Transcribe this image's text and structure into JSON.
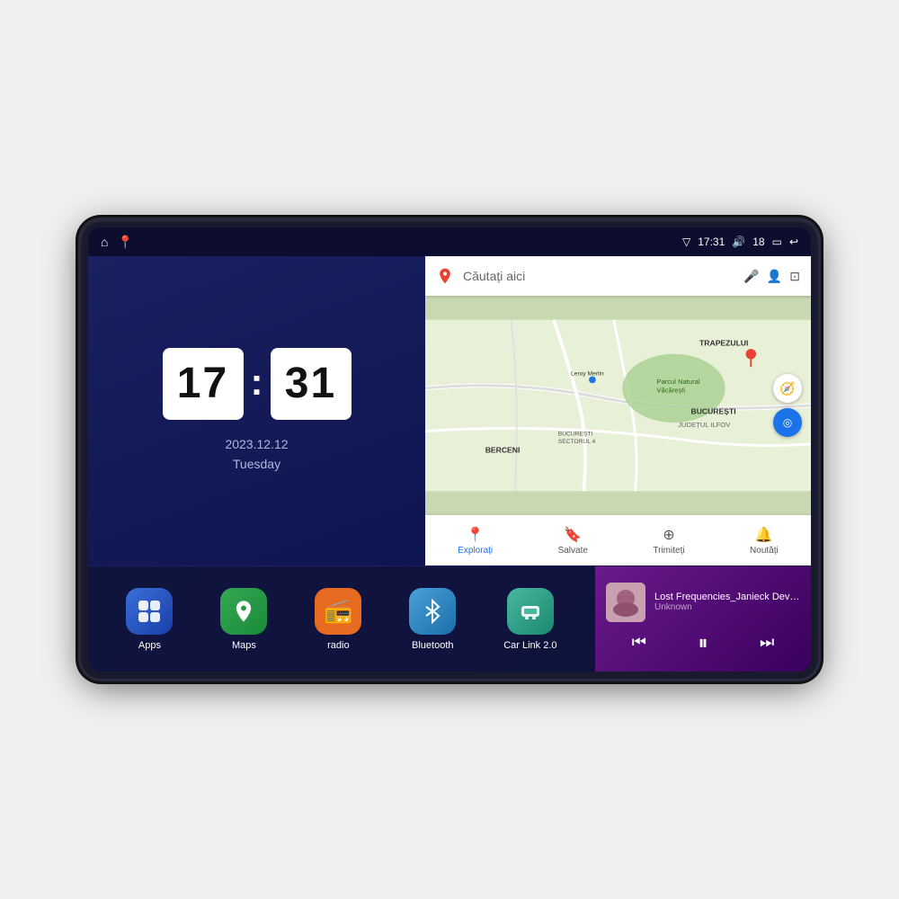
{
  "device": {
    "screen": {
      "status_bar": {
        "left_icons": [
          "home",
          "map-pin"
        ],
        "time": "17:31",
        "signal": "▽",
        "volume": "🔊",
        "battery_level": "18",
        "battery_icon": "🔋",
        "back_icon": "↩"
      },
      "clock": {
        "hours": "17",
        "minutes": "31",
        "date": "2023.12.12",
        "day": "Tuesday"
      },
      "map": {
        "search_placeholder": "Căutați aici",
        "bottom_nav": [
          {
            "label": "Explorați",
            "icon": "📍",
            "active": true
          },
          {
            "label": "Salvate",
            "icon": "🔖",
            "active": false
          },
          {
            "label": "Trimiteți",
            "icon": "⊕",
            "active": false
          },
          {
            "label": "Noutăți",
            "icon": "🔔",
            "active": false
          }
        ],
        "locations": [
          "TRAPEZULUI",
          "BUCUREȘTI",
          "JUDEȚUL ILFOV",
          "BERCENI",
          "Parcul Natural Văcărești",
          "Leroy Merlin",
          "BUCUREȘTI SECTORUL 4"
        ]
      },
      "apps": [
        {
          "id": "apps",
          "label": "Apps",
          "icon": "⊞",
          "bg": "apps-bg"
        },
        {
          "id": "maps",
          "label": "Maps",
          "icon": "📍",
          "bg": "maps-bg"
        },
        {
          "id": "radio",
          "label": "radio",
          "icon": "📻",
          "bg": "radio-bg"
        },
        {
          "id": "bluetooth",
          "label": "Bluetooth",
          "icon": "⚡",
          "bg": "bt-bg"
        },
        {
          "id": "carlink",
          "label": "Car Link 2.0",
          "icon": "🔗",
          "bg": "carlink-bg"
        }
      ],
      "music": {
        "title": "Lost Frequencies_Janieck Devy-...",
        "artist": "Unknown",
        "controls": {
          "prev": "⏮",
          "play": "⏸",
          "next": "⏭"
        }
      }
    }
  }
}
